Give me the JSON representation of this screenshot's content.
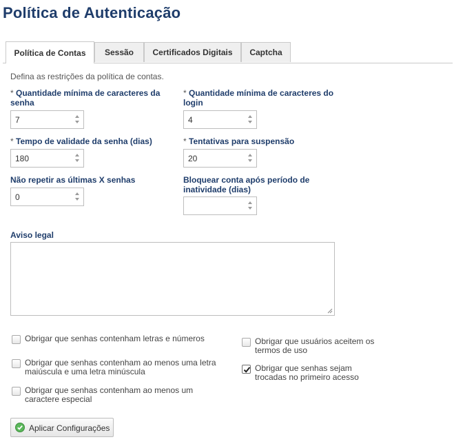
{
  "page": {
    "title": "Política de Autenticação"
  },
  "tabs": [
    {
      "label": "Política de Contas",
      "active": true
    },
    {
      "label": "Sessão",
      "active": false
    },
    {
      "label": "Certificados Digitais",
      "active": false
    },
    {
      "label": "Captcha",
      "active": false
    }
  ],
  "description": "Defina as restrições da política de contas.",
  "required_marker": "*",
  "fields": {
    "min_password_chars": {
      "label": "Quantidade mínima de caracteres da senha",
      "value": "7",
      "required": true
    },
    "min_login_chars": {
      "label": "Quantidade mínima de caracteres do login",
      "value": "4",
      "required": true
    },
    "password_validity_days": {
      "label": "Tempo de validade da senha (dias)",
      "value": "180",
      "required": true
    },
    "suspension_attempts": {
      "label": "Tentativas para suspensão",
      "value": "20",
      "required": true
    },
    "no_repeat_last": {
      "label": "Não repetir as últimas X senhas",
      "value": "0",
      "required": false
    },
    "lock_after_inactivity": {
      "label": "Bloquear conta após período de inatividade (dias)",
      "value": "",
      "required": false
    }
  },
  "legal_notice": {
    "label": "Aviso legal",
    "value": ""
  },
  "checkboxes": [
    {
      "label": "Obrigar que senhas contenham letras e números",
      "checked": false
    },
    {
      "label": "Obrigar que senhas contenham ao menos uma letra maiúscula e uma letra minúscula",
      "checked": false
    },
    {
      "label": "Obrigar que senhas contenham ao menos um caractere especial",
      "checked": false
    },
    {
      "label": "Obrigar que usuários aceitem os termos de uso",
      "checked": false
    },
    {
      "label": "Obrigar que senhas sejam trocadas no primeiro acesso",
      "checked": true
    }
  ],
  "apply_button": {
    "label": "Aplicar Configurações",
    "icon": "check-circle-icon"
  },
  "colors": {
    "title": "#1f3d6b",
    "label": "#1f3d6b",
    "ok_icon": "#5cb85c"
  }
}
